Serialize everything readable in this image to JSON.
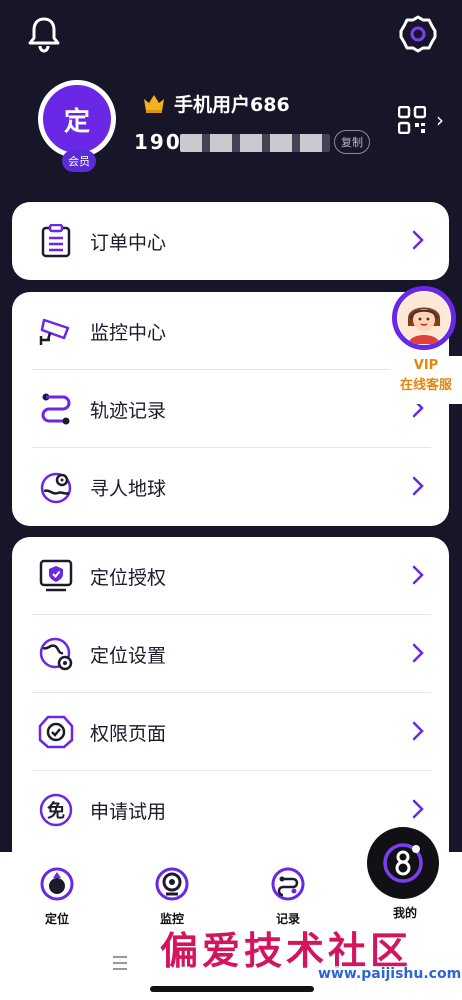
{
  "header": {
    "bell_icon": "bell-icon",
    "settings_icon": "gear-icon"
  },
  "profile": {
    "avatar_char": "定",
    "member_badge": "会员",
    "username": "手机用户686",
    "phone": "190",
    "copy_label": "复制",
    "qr_icon": "qr-code-icon"
  },
  "cards": [
    {
      "items": [
        {
          "label": "订单中心",
          "icon": "order-clipboard-icon"
        }
      ]
    },
    {
      "items": [
        {
          "label": "监控中心",
          "icon": "security-camera-icon"
        },
        {
          "label": "轨迹记录",
          "icon": "route-icon"
        },
        {
          "label": "寻人地球",
          "icon": "globe-search-icon"
        }
      ]
    },
    {
      "items": [
        {
          "label": "定位授权",
          "icon": "shield-screen-icon"
        },
        {
          "label": "定位设置",
          "icon": "globe-settings-icon"
        },
        {
          "label": "权限页面",
          "icon": "permission-badge-icon"
        },
        {
          "label": "申请试用",
          "icon": "free-trial-icon"
        }
      ]
    }
  ],
  "service": {
    "line1": "VIP",
    "line2": "在线客服"
  },
  "bottom_nav": {
    "items": [
      {
        "label": "定位",
        "icon": "location-icon"
      },
      {
        "label": "监控",
        "icon": "camera-icon"
      },
      {
        "label": "记录",
        "icon": "record-icon"
      },
      {
        "label": "我的",
        "icon": "profile-icon"
      }
    ]
  },
  "watermark": {
    "text": "偏爱技术社区",
    "url": "www.paijishu.com"
  },
  "colors": {
    "background": "#171628",
    "accent": "#6a27e6",
    "card": "#ffffff",
    "service_text": "#e8860c"
  }
}
